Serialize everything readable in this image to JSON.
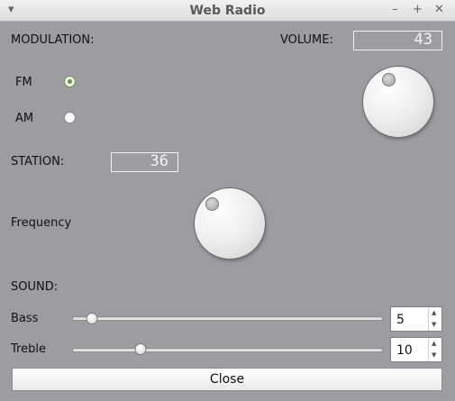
{
  "window": {
    "title": "Web Radio"
  },
  "modulation": {
    "label": "MODULATION:",
    "options": [
      "FM",
      "AM"
    ],
    "selected": "FM"
  },
  "volume": {
    "label": "VOLUME:",
    "value": "43"
  },
  "station": {
    "label": "STATION:",
    "value": "36"
  },
  "frequency": {
    "label": "Frequency"
  },
  "sound": {
    "label": "SOUND:",
    "bass": {
      "label": "Bass",
      "value": "5",
      "slider_level": 0.065
    },
    "treble": {
      "label": "Treble",
      "value": "10",
      "slider_level": 0.22
    }
  },
  "buttons": {
    "close_label": "Close"
  }
}
